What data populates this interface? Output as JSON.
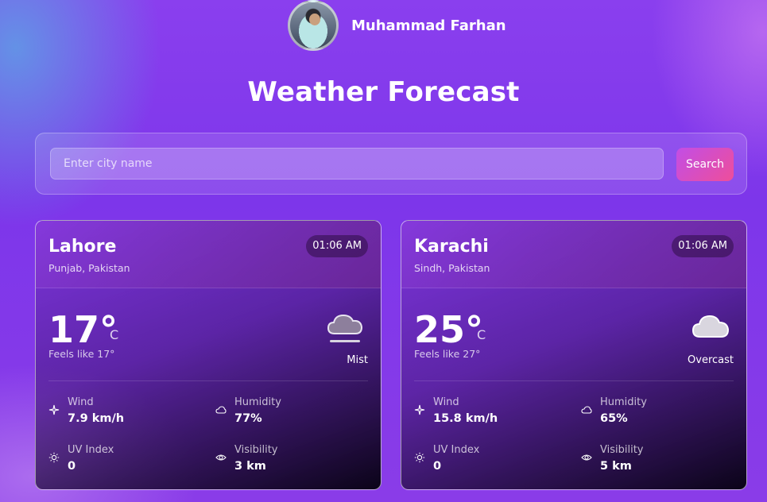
{
  "profile": {
    "name": "Muhammad Farhan"
  },
  "page": {
    "title": "Weather Forecast"
  },
  "search": {
    "placeholder": "Enter city name",
    "value": "",
    "button_label": "Search"
  },
  "cards": [
    {
      "city": "Lahore",
      "region": "Punjab, Pakistan",
      "time": "01:06 AM",
      "temp": "17°",
      "unit": "C",
      "feels_like": "Feels like 17°",
      "condition": "Mist",
      "condition_icon": "mist-icon",
      "wind_label": "Wind",
      "wind_value": "7.9 km/h",
      "humidity_label": "Humidity",
      "humidity_value": "77%",
      "uv_label": "UV Index",
      "uv_value": "0",
      "visibility_label": "Visibility",
      "visibility_value": "3 km"
    },
    {
      "city": "Karachi",
      "region": "Sindh, Pakistan",
      "time": "01:06 AM",
      "temp": "25°",
      "unit": "C",
      "feels_like": "Feels like 27°",
      "condition": "Overcast",
      "condition_icon": "cloud-icon",
      "wind_label": "Wind",
      "wind_value": "15.8 km/h",
      "humidity_label": "Humidity",
      "humidity_value": "65%",
      "uv_label": "UV Index",
      "uv_value": "0",
      "visibility_label": "Visibility",
      "visibility_value": "5 km"
    }
  ],
  "colors": {
    "accent_start": "#c24ee6",
    "accent_end": "#ee4e9a",
    "background": "#8a3fee"
  }
}
